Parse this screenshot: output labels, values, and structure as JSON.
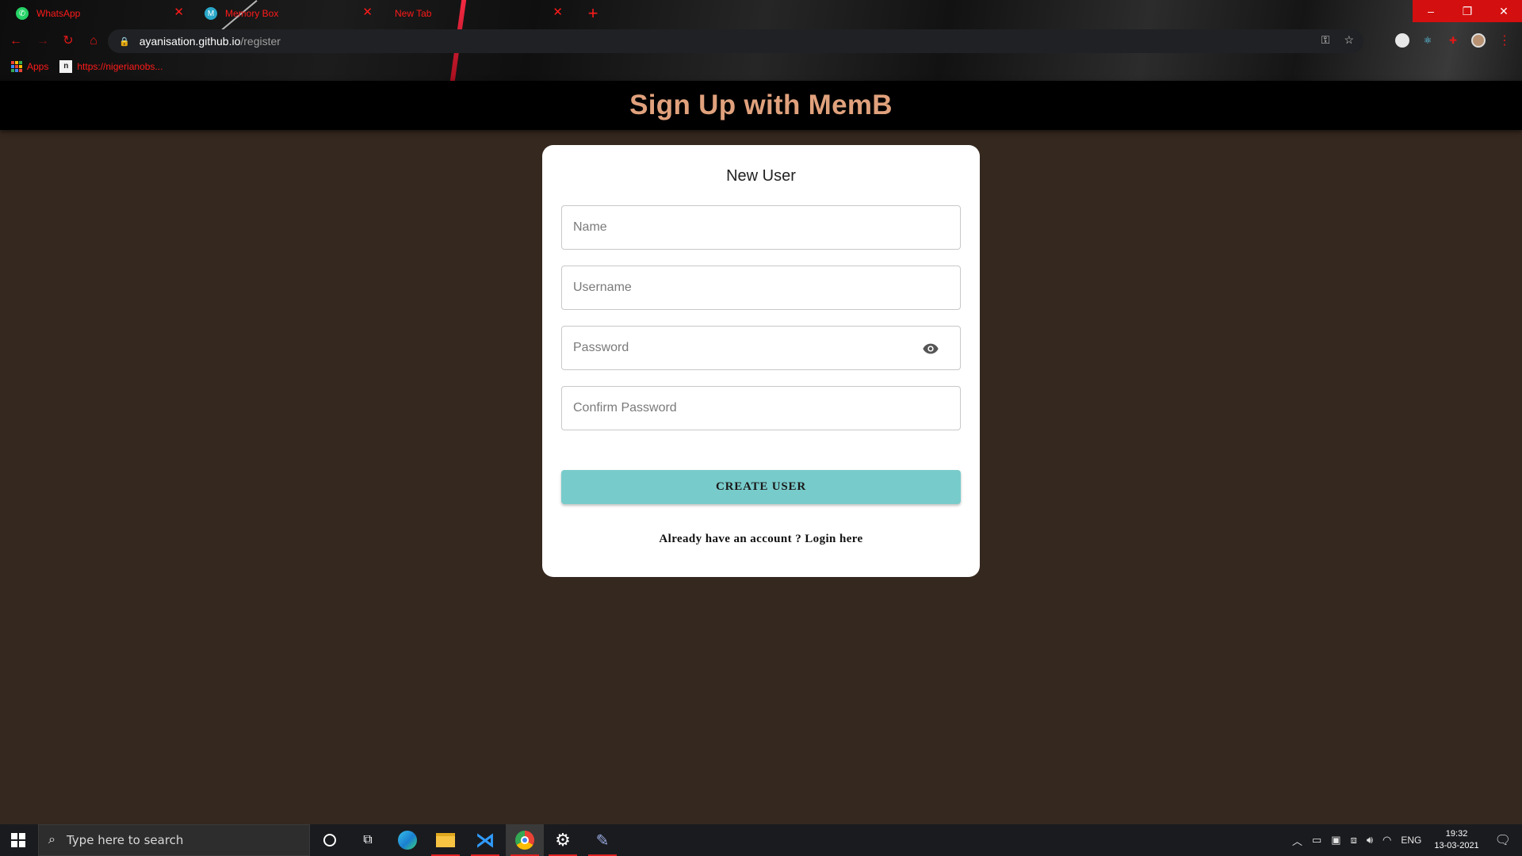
{
  "browser": {
    "tabs": [
      {
        "title": "WhatsApp",
        "icon": "whatsapp-icon",
        "color": "#25d366"
      },
      {
        "title": "Memory Box",
        "icon": "memory-box-favicon",
        "color": "#2aa7c9"
      },
      {
        "title": "New Tab",
        "icon": "",
        "color": ""
      }
    ],
    "url_host": "ayanisation.github.io",
    "url_path": "/register",
    "bookmarks": [
      {
        "label": "Apps",
        "icon": "apps-grid-icon"
      },
      {
        "label": "https://nigerianobs...",
        "icon": "bookmark-favicon"
      }
    ],
    "accent_color": "#ff1a1a"
  },
  "page": {
    "header_title": "Sign Up with MemB",
    "header_color": "#e0a17c",
    "background_color": "#35281f",
    "card": {
      "title": "New User",
      "fields": {
        "name_placeholder": "Name",
        "username_placeholder": "Username",
        "password_placeholder": "Password",
        "confirm_placeholder": "Confirm Password"
      },
      "button_label": "CREATE USER",
      "button_color": "#78cbcb",
      "login_prefix": "Already have an account ?",
      "login_link": "Login here"
    }
  },
  "taskbar": {
    "search_placeholder": "Type here to search",
    "language": "ENG",
    "time": "19:32",
    "date": "13-03-2021"
  }
}
